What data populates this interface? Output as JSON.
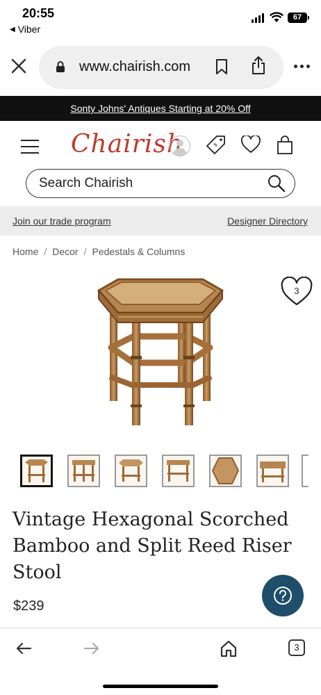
{
  "status_bar": {
    "time": "20:55",
    "back_app": "Viber",
    "battery": "67"
  },
  "browser": {
    "url": "www.chairish.com",
    "tab_count": "3"
  },
  "promo": {
    "text": "Sonty Johns' Antiques Starting at 20% Off"
  },
  "header": {
    "logo": "Chairish",
    "search_placeholder": "Search Chairish"
  },
  "trade_strip": {
    "left_link": "Join our trade program",
    "right_link": "Designer Directory"
  },
  "breadcrumb": [
    "Home",
    "Decor",
    "Pedestals & Columns"
  ],
  "product": {
    "favorite_count": "3",
    "thumbnail_count": 7,
    "title": "Vintage Hexagonal Scorched Bamboo and Split Reed Riser Stool",
    "price": "$239"
  },
  "icons": {
    "close": "close-icon",
    "lock": "lock-icon",
    "bookmark": "bookmark-icon",
    "share": "share-icon",
    "more": "more-icon",
    "menu": "hamburger-menu-icon",
    "account": "avatar-icon",
    "price_tag": "price-tag-icon",
    "favorites": "heart-icon",
    "cart": "shopping-bag-icon",
    "search": "search-icon",
    "help": "question-icon",
    "back": "arrow-left-icon",
    "forward": "arrow-right-icon",
    "home": "home-icon"
  },
  "colors": {
    "brand_red": "#c0392b",
    "promo_bg": "#111111",
    "help_button": "#1f4e6b",
    "trade_strip_bg": "#ececec"
  }
}
